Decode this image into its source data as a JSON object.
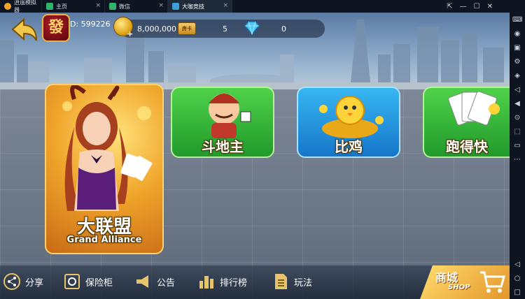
{
  "emulator": {
    "tabs": [
      {
        "label": "逍遥模拟器",
        "color": "#f2a52b"
      },
      {
        "label": "主页",
        "color": "#2fb46a"
      },
      {
        "label": "微信",
        "color": "#2fb46a"
      },
      {
        "label": "大咖竞技",
        "color": "#3fa0d8"
      }
    ],
    "close_glyph": "×",
    "window_controls": [
      "⇱",
      "—",
      "☐",
      "✕"
    ],
    "sidebar_icons": [
      "keyboard-icon",
      "gamepad-icon",
      "apk-icon",
      "settings-icon",
      "shake-icon",
      "volume-up-icon",
      "volume-down-icon",
      "location-icon",
      "screenshot-icon",
      "folder-icon",
      "more-icon",
      "back-icon",
      "home-icon",
      "recent-icon"
    ]
  },
  "hud": {
    "avatar_glyph": "發",
    "user_id": "D:  599226",
    "coins": "8,000,000",
    "coin_plus": "+",
    "ticket_label": "房卡",
    "tickets": "5",
    "gems": "0"
  },
  "cards": {
    "alliance_cn": "大联盟",
    "alliance_en": "Grand Alliance",
    "ddz": "斗地主",
    "biji": "比鸡",
    "pdk": "跑得快"
  },
  "bottom_nav": [
    {
      "label": "分享",
      "icon": "share-icon"
    },
    {
      "label": "保险柜",
      "icon": "safe-icon"
    },
    {
      "label": "公告",
      "icon": "megaphone-icon"
    },
    {
      "label": "排行榜",
      "icon": "leaderboard-icon"
    },
    {
      "label": "玩法",
      "icon": "rules-icon"
    }
  ],
  "shop": {
    "cn": "商城",
    "en": "SHOP"
  },
  "colors": {
    "gold": "#f0a52b",
    "green": "#219a2b",
    "blue": "#1676c9"
  }
}
